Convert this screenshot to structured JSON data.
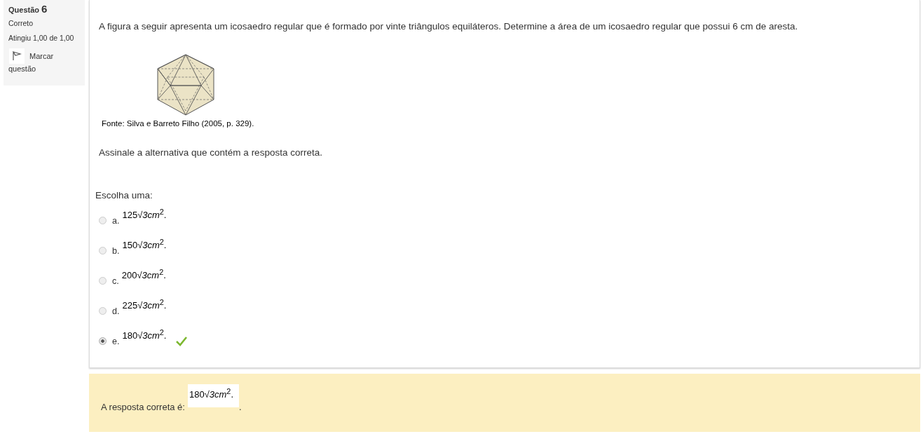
{
  "info": {
    "label": "Questão",
    "number": "6",
    "state": "Correto",
    "grade": "Atingiu 1,00 de 1,00",
    "flag": {
      "label": "Marcar questão",
      "flagged": false
    }
  },
  "question": {
    "text": "A figura a seguir apresenta um icosaedro regular que é formado por vinte triângulos equiláteros. Determine a área de um icosaedro regular que possui 6 cm de aresta.",
    "caption": "Fonte: Silva e Barreto Filho (2005, p. 329).",
    "instruction": "Assinale a alternativa que contém a resposta correta.",
    "prompt": "Escolha uma:",
    "options": [
      {
        "letter": "a.",
        "answer": "125√*3cm*$^{2}$.",
        "selected": false,
        "correct": false
      },
      {
        "letter": "b.",
        "answer": "150√*3cm*$^{2}$.",
        "selected": false,
        "correct": false
      },
      {
        "letter": "c.",
        "answer": "200√*3cm*$^{2}$.",
        "selected": false,
        "correct": false
      },
      {
        "letter": "d.",
        "answer": "225√*3cm*$^{2}$.",
        "selected": false,
        "correct": false
      },
      {
        "letter": "e.",
        "answer": "180√*3cm*$^{2}$.",
        "selected": true,
        "correct": true
      }
    ]
  },
  "feedback": {
    "label": "A resposta correta é:",
    "answer": "180√*3cm*$^{2}$.",
    "end": "."
  }
}
